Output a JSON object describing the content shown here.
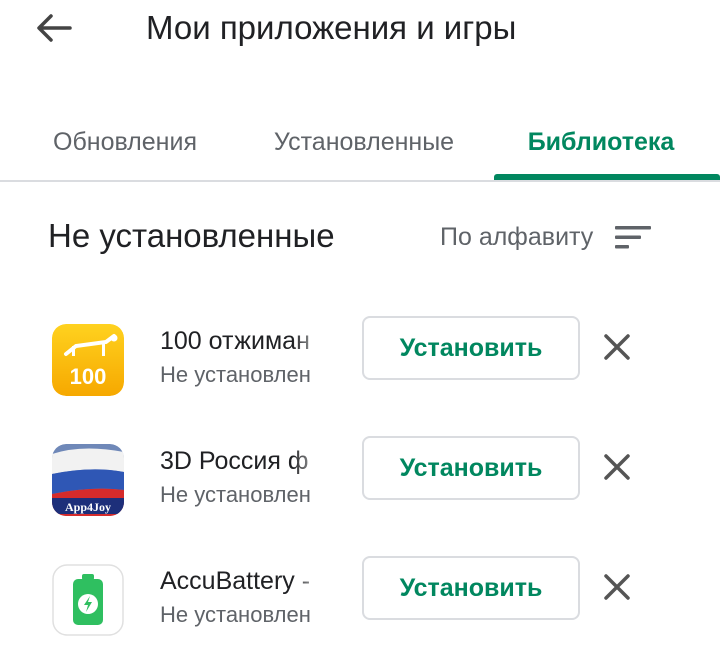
{
  "header": {
    "back_icon": "arrow-left-icon",
    "title": "Мои приложения и игры"
  },
  "tabs": [
    {
      "label": "Обновления",
      "active": false
    },
    {
      "label": "Установленные",
      "active": false
    },
    {
      "label": "Библиотека",
      "active": true
    }
  ],
  "colors": {
    "accent": "#01875f",
    "text_primary": "#202124",
    "text_secondary": "#5f6368",
    "divider": "#dadce0"
  },
  "section": {
    "title": "Не установленные",
    "sort_label": "По алфавиту",
    "sort_icon": "sort-icon"
  },
  "apps": [
    {
      "name": "100 отжиман",
      "status": "Не установлен",
      "install_label": "Установить",
      "icon": "pushup-100-app-icon",
      "icon_text": "100",
      "remove_icon": "close-icon"
    },
    {
      "name": "3D Россия ф",
      "status": "Не установлен",
      "install_label": "Установить",
      "icon": "russia-flag-app-icon",
      "icon_text": "App4Joy",
      "remove_icon": "close-icon"
    },
    {
      "name": "AccuBattery -",
      "status": "Не установлен",
      "install_label": "Установить",
      "icon": "battery-app-icon",
      "remove_icon": "close-icon"
    }
  ]
}
